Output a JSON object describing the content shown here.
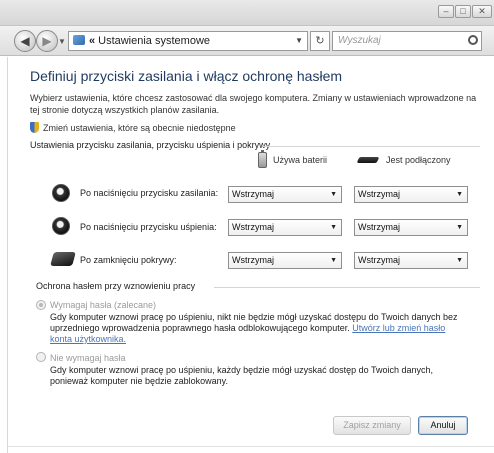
{
  "window": {
    "buttons": [
      "–",
      "□",
      "✕"
    ]
  },
  "nav": {
    "address": "Ustawienia systemowe",
    "address_prefix": "«",
    "search_placeholder": "Wyszukaj",
    "refresh_glyph": "↻"
  },
  "page": {
    "title": "Definiuj przyciski zasilania i włącz ochronę hasłem",
    "intro": "Wybierz ustawienia, które chcesz zastosować dla swojego komputera. Zmiany w ustawieniach wprowadzone na tej stronie dotyczą wszystkich planów zasilania.",
    "change_link": "Zmień ustawienia, które są obecnie niedostępne"
  },
  "power_section": {
    "title": "Ustawienia przycisku zasilania, przycisku uśpienia i pokrywy",
    "col_battery": "Używa baterii",
    "col_plugged": "Jest podłączony",
    "rows": [
      {
        "label": "Po naciśnięciu przycisku zasilania:",
        "battery": "Wstrzymaj",
        "plugged": "Wstrzymaj",
        "icon": "power-icon"
      },
      {
        "label": "Po naciśnięciu przycisku uśpienia:",
        "battery": "Wstrzymaj",
        "plugged": "Wstrzymaj",
        "icon": "sleep-icon"
      },
      {
        "label": "Po zamknięciu pokrywy:",
        "battery": "Wstrzymaj",
        "plugged": "Wstrzymaj",
        "icon": "lid-icon"
      }
    ]
  },
  "password_section": {
    "title": "Ochrona hasłem przy wznowieniu pracy",
    "option1_label": "Wymagaj hasła (zalecane)",
    "option1_desc_a": "Gdy komputer wznowi pracę po uśpieniu, nikt nie będzie mógł uzyskać dostępu do Twoich danych bez uprzedniego wprowadzenia poprawnego hasła odblokowującego komputer.",
    "option1_link": "Utwórz lub zmień hasło konta użytkownika.",
    "option2_label": "Nie wymagaj hasła",
    "option2_desc": "Gdy komputer wznowi pracę po uśpieniu, każdy będzie mógł uzyskać dostęp do Twoich danych, ponieważ komputer nie będzie zablokowany."
  },
  "footer": {
    "save": "Zapisz zmiany",
    "cancel": "Anuluj"
  },
  "colors": {
    "title": "#1e3a5f",
    "link": "#4a74b8"
  }
}
